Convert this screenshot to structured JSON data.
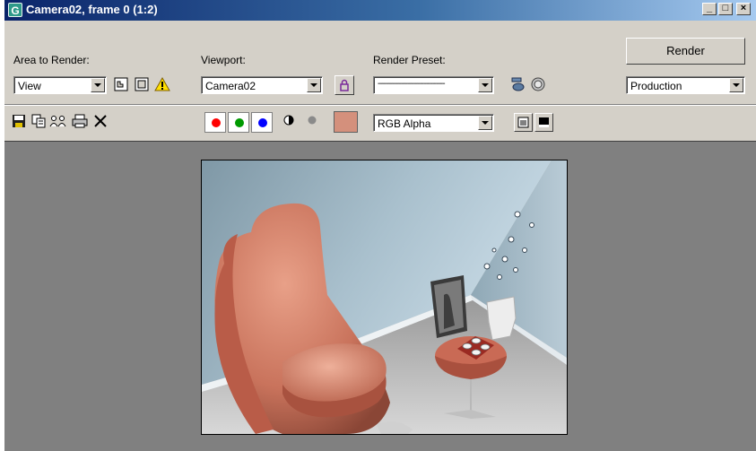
{
  "window": {
    "title": "Camera02, frame 0 (1:2)",
    "app_icon": "app-icon",
    "caption_buttons": {
      "minimize": "_",
      "maximize": "□",
      "close": "×"
    }
  },
  "toolbar": {
    "area_label": "Area to Render:",
    "area_value": "View",
    "viewport_label": "Viewport:",
    "viewport_value": "Camera02",
    "preset_label": "Render Preset:",
    "preset_value": "--------------------------------",
    "render_button": "Render",
    "production_value": "Production",
    "channel_display": "RGB Alpha",
    "swatch_color": "#d4907c"
  },
  "colors": {
    "title_start": "#0a246a",
    "title_end": "#a6caf0",
    "panel": "#d4d0c8",
    "viewport_bg": "#808080",
    "red_channel": "#ff0000",
    "green_channel": "#009a00",
    "blue_channel": "#0000ff"
  },
  "icons": {
    "save": "save-icon",
    "copy": "copy-icon",
    "clone": "clone-window-icon",
    "print": "print-icon",
    "clear": "clear-icon",
    "warning": "warning-icon",
    "lock": "lock-icon"
  }
}
